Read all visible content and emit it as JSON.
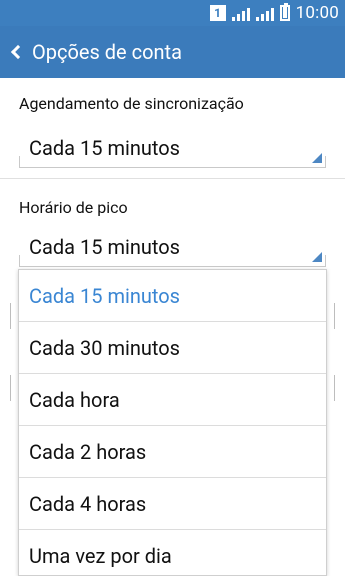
{
  "status_bar": {
    "sim_badge": "1",
    "time": "10:00"
  },
  "app_bar": {
    "title": "Opções de conta"
  },
  "settings": {
    "sync_schedule_label": "Agendamento de sincronização",
    "sync_schedule_value": "Cada 15 minutos",
    "peak_time_label": "Horário de pico",
    "peak_time_value": "Cada 15 minutos"
  },
  "dropdown": {
    "options": [
      {
        "label": "Cada 15 minutos",
        "selected": true
      },
      {
        "label": "Cada 30 minutos",
        "selected": false
      },
      {
        "label": "Cada hora",
        "selected": false
      },
      {
        "label": "Cada 2 horas",
        "selected": false
      },
      {
        "label": "Cada 4 horas",
        "selected": false
      },
      {
        "label": "Uma vez por dia",
        "selected": false
      }
    ]
  },
  "colors": {
    "status_bar": "#3d7fbf",
    "app_bar": "#3b7bbb",
    "selected_option": "#3a86d3",
    "spinner_triangle": "#4d87c3"
  }
}
